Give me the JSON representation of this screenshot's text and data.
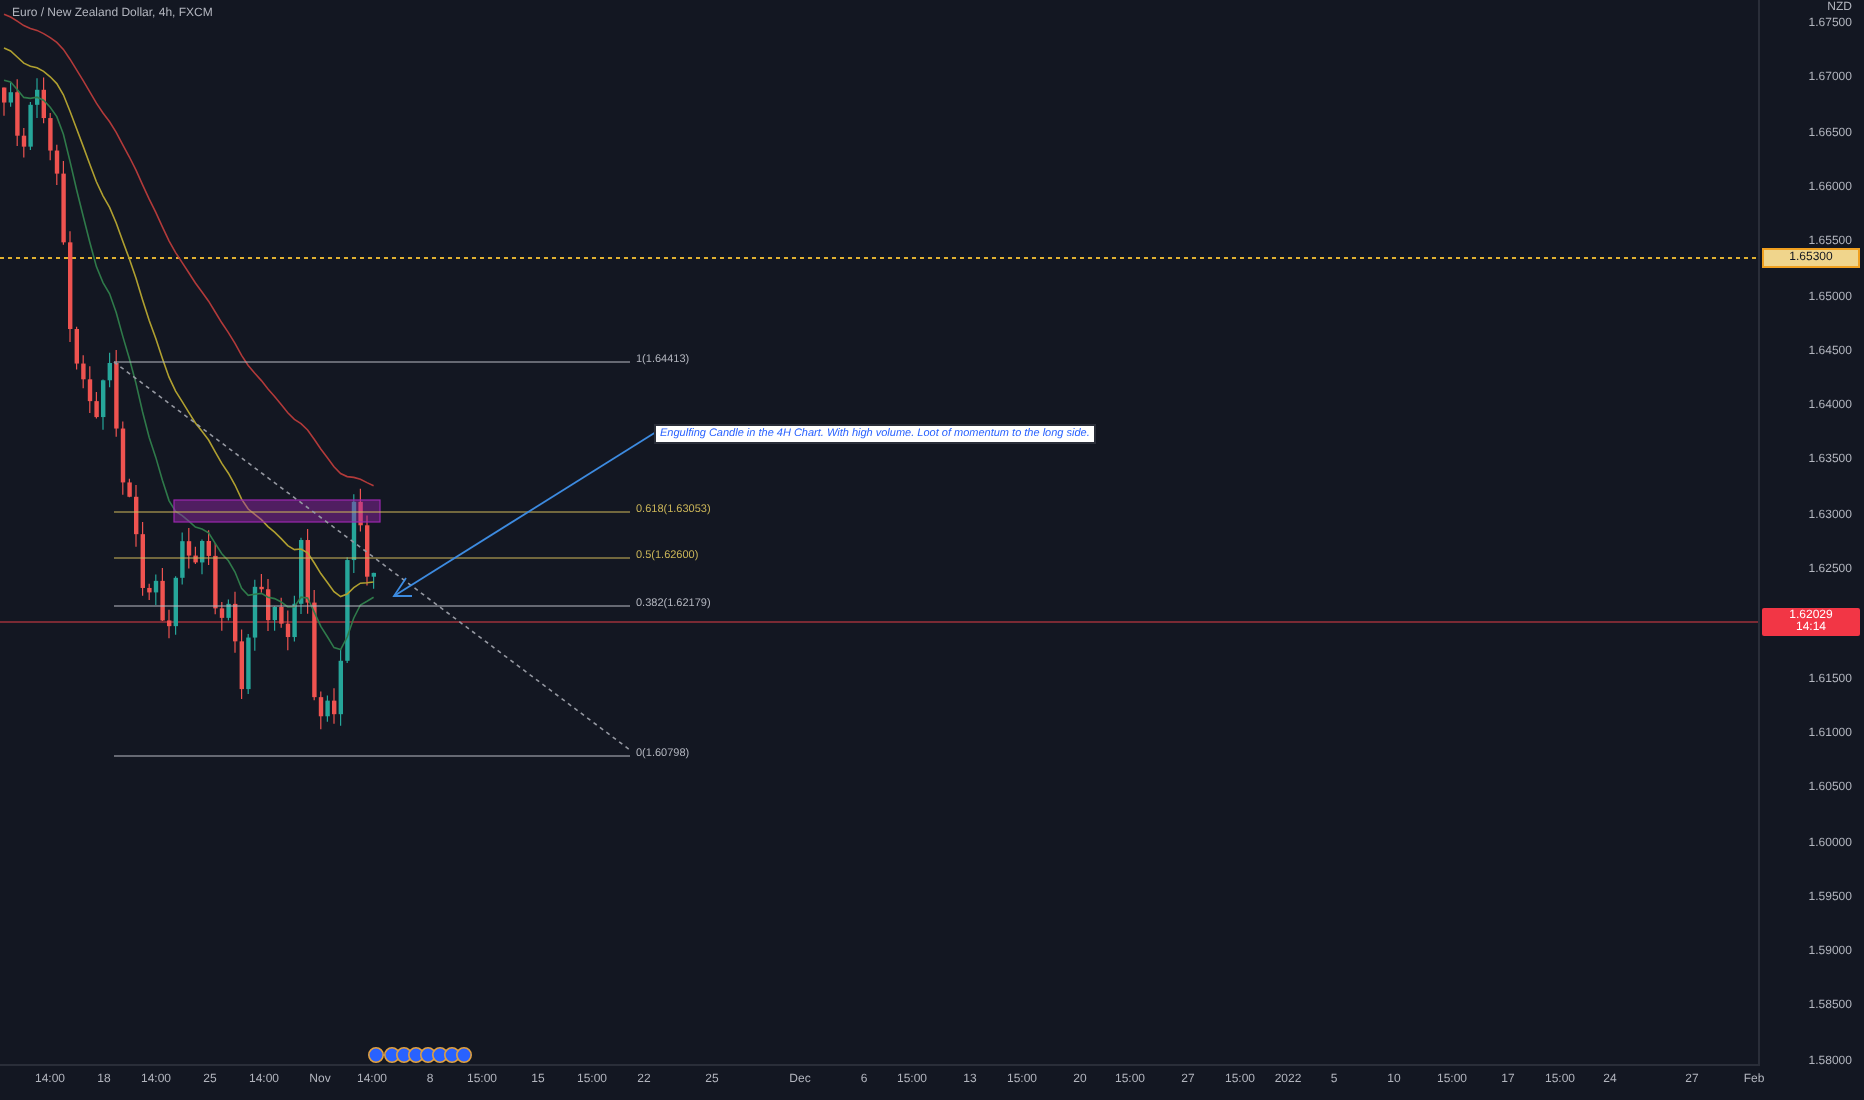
{
  "chart": {
    "title": "Euro / New Zealand Dollar, 4h, FXCM",
    "currency": "NZD",
    "price_ticks": [
      "1.67500",
      "1.67000",
      "1.66500",
      "1.66000",
      "1.65500",
      "1.65000",
      "1.64500",
      "1.64000",
      "1.63500",
      "1.63000",
      "1.62500",
      "1.61500",
      "1.61000",
      "1.60500",
      "1.60000",
      "1.59500",
      "1.59000",
      "1.58500",
      "1.58000"
    ],
    "alert_price": "1.65300",
    "current_price": "1.62029",
    "countdown": "14:14",
    "fib_levels": [
      {
        "label": "1(1.64413)",
        "color": "#b2b5be"
      },
      {
        "label": "0.618(1.63053)",
        "color": "#c9b458"
      },
      {
        "label": "0.5(1.62600)",
        "color": "#c9b458"
      },
      {
        "label": "0.382(1.62179)",
        "color": "#b2b5be"
      },
      {
        "label": "0(1.60798)",
        "color": "#b2b5be"
      }
    ],
    "annotation": "Engulfing Candle in the 4H Chart. With high volume. Loot of momentum to the long side.",
    "time_ticks": [
      "14:00",
      "18",
      "14:00",
      "25",
      "14:00",
      "Nov",
      "14:00",
      "8",
      "15:00",
      "15",
      "15:00",
      "22",
      "25",
      "Dec",
      "6",
      "15:00",
      "13",
      "15:00",
      "20",
      "15:00",
      "27",
      "15:00",
      "2022",
      "5",
      "10",
      "15:00",
      "17",
      "15:00",
      "24",
      "27",
      "Feb"
    ]
  }
}
